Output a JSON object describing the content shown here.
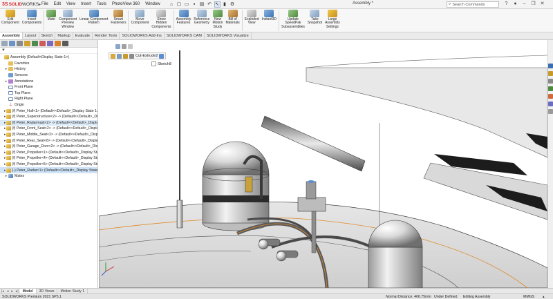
{
  "app": {
    "logo_mark": "3S",
    "logo_brand": "SOLID",
    "logo_brand2": "WORKS",
    "document_title": "Assembly *"
  },
  "menus": [
    "File",
    "Edit",
    "View",
    "Insert",
    "Tools",
    "PhotoView 360",
    "Window"
  ],
  "search": {
    "placeholder": "Search Commands"
  },
  "ribbon": [
    {
      "label": "Edit\nComponent",
      "icon": "edit-component-icon"
    },
    {
      "label": "Insert\nComponents",
      "icon": "insert-components-icon"
    },
    {
      "label": "Mate",
      "icon": "mate-icon"
    },
    {
      "label": "Component\nPreview\nWindow",
      "icon": "component-preview-icon"
    },
    {
      "label": "Linear Component\nPattern",
      "icon": "linear-pattern-icon"
    },
    {
      "label": "Smart\nFasteners",
      "icon": "smart-fasteners-icon"
    },
    {
      "label": "Move\nComponent",
      "icon": "move-component-icon"
    },
    {
      "label": "Show\nHidden\nComponents",
      "icon": "show-hidden-icon"
    },
    {
      "label": "Assembly\nFeatures",
      "icon": "assembly-features-icon"
    },
    {
      "label": "Reference\nGeometry",
      "icon": "reference-geometry-icon"
    },
    {
      "label": "New\nMotion\nStudy",
      "icon": "motion-study-icon"
    },
    {
      "label": "Bill of\nMaterials",
      "icon": "bom-icon"
    },
    {
      "label": "Exploded\nView",
      "icon": "exploded-view-icon"
    },
    {
      "label": "Instant3D",
      "icon": "instant3d-icon"
    },
    {
      "label": "Update\nSpeedPak\nSubassemblies",
      "icon": "speedpak-icon"
    },
    {
      "label": "Take\nSnapshot",
      "icon": "snapshot-icon"
    },
    {
      "label": "Large\nAssembly\nSettings",
      "icon": "large-assembly-icon"
    }
  ],
  "tabs": [
    "Assembly",
    "Layout",
    "Sketch",
    "Markup",
    "Evaluate",
    "Render Tools",
    "SOLIDWORKS Add-Ins",
    "SOLIDWORKS CAM",
    "SOLIDWORKS Visualize"
  ],
  "tree": [
    {
      "label": "Assembly  (Default<Display State-1>)",
      "icon": "asm",
      "indent": 0,
      "exp": ""
    },
    {
      "label": "Favorites",
      "icon": "folder",
      "indent": 1,
      "exp": ""
    },
    {
      "label": "History",
      "icon": "folder",
      "indent": 1,
      "exp": ">"
    },
    {
      "label": "Sensors",
      "icon": "sensor",
      "indent": 1,
      "exp": ""
    },
    {
      "label": "Annotations",
      "icon": "annot",
      "indent": 1,
      "exp": ">"
    },
    {
      "label": "Front Plane",
      "icon": "plane",
      "indent": 1,
      "exp": ""
    },
    {
      "label": "Top Plane",
      "icon": "plane",
      "indent": 1,
      "exp": ""
    },
    {
      "label": "Right Plane",
      "icon": "plane",
      "indent": 1,
      "exp": ""
    },
    {
      "label": "Origin",
      "icon": "origin",
      "indent": 1,
      "exp": ""
    },
    {
      "label": "(f) Peter_Hull<1> (Default<<Default>_Display State 1>",
      "icon": "part",
      "indent": 1,
      "exp": ">"
    },
    {
      "label": "(f) Peter_Superstructure<2> -> (Default<<Default>_Disp",
      "icon": "part",
      "indent": 1,
      "exp": ">"
    },
    {
      "label": "(f) Peter_Radarmast<2> -> (Default<<Default>_Display",
      "icon": "part",
      "indent": 1,
      "exp": ">",
      "sel": "sel2"
    },
    {
      "label": "(f) Peter_Front_Seat<2> -> (Default<<Default>_Display",
      "icon": "part",
      "indent": 1,
      "exp": ">"
    },
    {
      "label": "(f) Peter_Middle_Seat<2> -> (Default<<Default>_Displa",
      "icon": "part",
      "indent": 1,
      "exp": ">"
    },
    {
      "label": "(f) Peter_Rear_Seat<8> -> (Default<<Default>_Display",
      "icon": "part",
      "indent": 1,
      "exp": ">"
    },
    {
      "label": "(f) Peter_Garage_Door<2> -> (Default<<Default>_Disp",
      "icon": "part",
      "indent": 1,
      "exp": ">"
    },
    {
      "label": "(f) Peter_Propeller<1> (Default<<Default>_Display Stat",
      "icon": "part",
      "indent": 1,
      "exp": ">"
    },
    {
      "label": "(f) Peter_Propeller<4> (Default<<Default>_Display Stat",
      "icon": "part",
      "indent": 1,
      "exp": ">"
    },
    {
      "label": "(f) Peter_Propeller<5> (Default<<Default>_Display Stat",
      "icon": "part",
      "indent": 1,
      "exp": ">"
    },
    {
      "label": "(-) Peter_Radar<1> (Default<<Default>_Display State 1",
      "icon": "part",
      "indent": 1,
      "exp": ">",
      "sel": "sel"
    },
    {
      "label": "Mates",
      "icon": "mates",
      "indent": 1,
      "exp": ">"
    }
  ],
  "viewport": {
    "cut_label": "Cut-Extrude2",
    "sketch_label": "Sketch8"
  },
  "bottom_tabs": [
    "Model",
    "3D Views",
    "Motion Study 1"
  ],
  "status": {
    "product": "SOLIDWORKS Premium 2021 SP5.1",
    "distance": "Normal Distance: 466.75mm",
    "defined": "Under Defined",
    "mode": "Editing Assembly",
    "units": "MMGS"
  },
  "colors": {
    "accent": "#d8272e",
    "selection": "#cfe3f7",
    "edge_highlight": "#e08a2a"
  }
}
